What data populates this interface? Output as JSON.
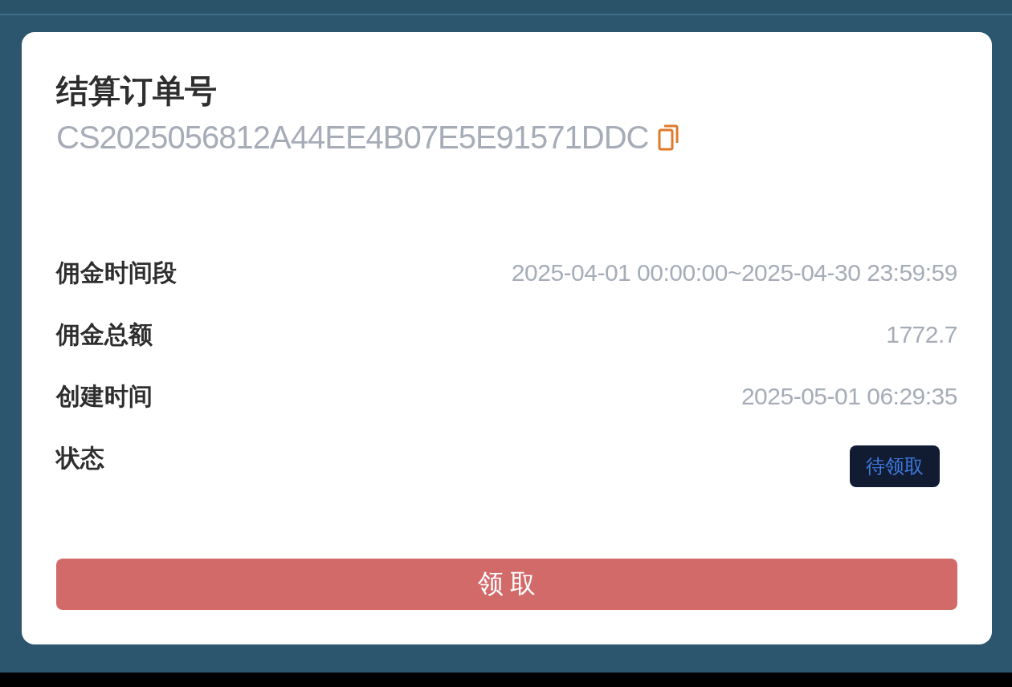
{
  "order": {
    "title": "结算订单号",
    "number": "CS2025056812A44EE4B07E5E91571DDC"
  },
  "details": [
    {
      "kind": "text",
      "label": "佣金时间段",
      "value": "2025-04-01 00:00:00~2025-04-30 23:59:59"
    },
    {
      "kind": "text",
      "label": "佣金总额",
      "value": "1772.7"
    },
    {
      "kind": "text",
      "label": "创建时间",
      "value": "2025-05-01 06:29:35"
    },
    {
      "kind": "badge",
      "label": "状态",
      "value": "待领取"
    }
  ],
  "action_button": {
    "label": "领 取"
  }
}
